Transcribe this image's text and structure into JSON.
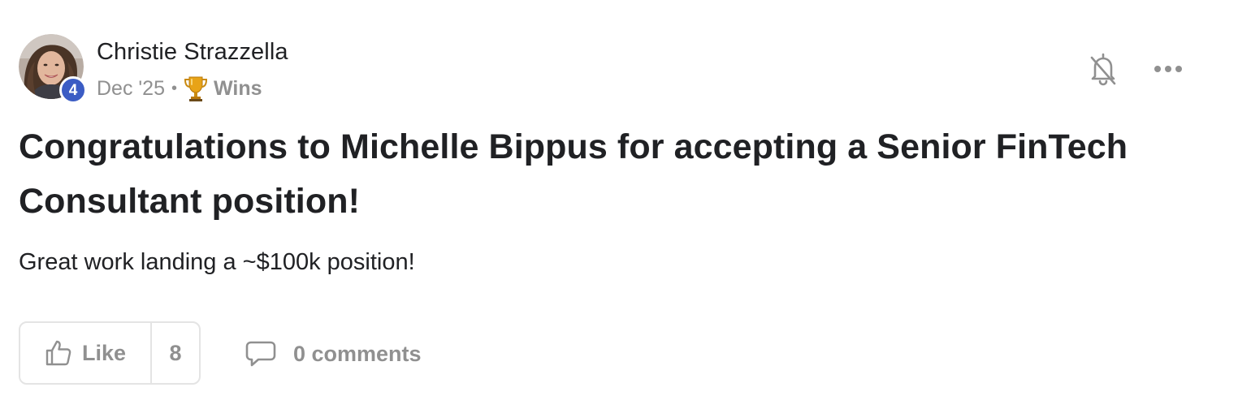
{
  "post": {
    "author": {
      "name": "Christie Strazzella",
      "level": "4"
    },
    "meta": {
      "date": "Dec '25",
      "separator": "•",
      "category": "Wins",
      "category_icon": "trophy-icon"
    },
    "actions": {
      "bell_icon": "bell-off-icon",
      "more_icon": "more-horizontal-icon"
    },
    "title": "Congratulations to Michelle Bippus for accepting a Senior FinTech Consultant position!",
    "body": "Great work landing a ~$100k position!",
    "reactions": {
      "like_label": "Like",
      "like_count": "8",
      "comments_label": "0 comments"
    }
  },
  "colors": {
    "level_badge": "#3b5cc4",
    "muted_text": "#909090",
    "primary_text": "#202124",
    "border": "#e4e4e4"
  }
}
